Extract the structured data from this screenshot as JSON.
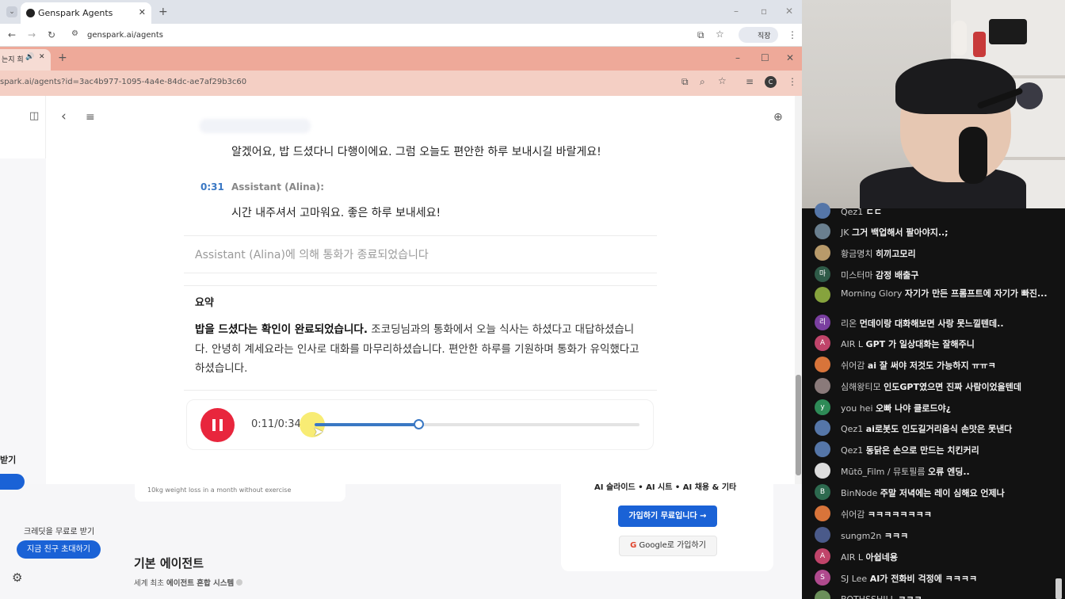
{
  "back_browser": {
    "tab_title": "Genspark Agents",
    "url": "genspark.ai/agents",
    "profile_label": "직장"
  },
  "front_browser": {
    "tab_title": "는지 희",
    "url": "spark.ai/agents?id=3ac4b977-1095-4a4e-84dc-ae7af29b3c60",
    "profile_initial": "C"
  },
  "transcript": {
    "top_message": "알겠어요, 밥 드셨다니 다행이에요. 그럼 오늘도 편안한 하루 보내시길 바랄게요!",
    "entry_time": "0:31",
    "entry_speaker": "Assistant (Alina):",
    "entry_message": "시간 내주셔서 고마워요. 좋은 하루 보내세요!",
    "end_notice": "Assistant (Alina)에 의해 통화가 종료되었습니다"
  },
  "summary": {
    "title": "요약",
    "bold_sentence": "밥을 드셨다는 확인이 완료되었습니다.",
    "body": " 조코딩님과의 통화에서 오늘 식사는 하셨다고 대답하셨습니다. 안녕히 계세요라는 인사로 대화를 마무리하셨습니다. 편안한 하루를 기원하며 통화가 유익했다고 하셨습니다."
  },
  "player": {
    "time": "0:11/0:34",
    "progress": 0.32
  },
  "lower_page": {
    "card_hint": "10kg weight loss in a month without exercise",
    "credit_text": "크레딧을 무료로 받기",
    "invite_button": "지금 친구 초대하기",
    "side_label": "받기",
    "section_title": "기본 에이전트",
    "section_sub_prefix": "세계 최초 ",
    "section_sub_bold": "에이전트 혼합 시스템",
    "right_card_heading": "AI 슬라이드 • AI 시트 • AI 채용 & 기타",
    "signup_button": "가입하기  무료입니다  →",
    "google_button": "Google로 가입하기"
  },
  "chat": [
    {
      "avatar": "",
      "user": "Qez1",
      "text": "ㄷㄷ",
      "color": "#5576a8"
    },
    {
      "avatar": "",
      "user": "JK",
      "text": "그거 백업해서 팔아야지..;",
      "color": "#6a7f8f"
    },
    {
      "avatar": "",
      "user": "황금명치",
      "text": "히끼고모리",
      "color": "#b89a6a"
    },
    {
      "avatar": "마",
      "user": "미스터마",
      "text": "감정 배출구",
      "color": "#2f5b48"
    },
    {
      "avatar": "",
      "user": "Morning Glory",
      "text": "자기가 만든 프롬프트에 자기가 빠진...",
      "color": "#86a33d"
    },
    {
      "avatar": "리",
      "user": "리온",
      "text": "먼데이랑 대화해보면 사랑 못느낄텐데..",
      "color": "#7a3fa0"
    },
    {
      "avatar": "A",
      "user": "AIR L",
      "text": "GPT 가 일상대화는 잘해주니",
      "color": "#c0446a"
    },
    {
      "avatar": "",
      "user": "쉬어감",
      "text": "ai 잘 써야 저것도 가능하지 ㅠㅠㅋ",
      "color": "#d8743a"
    },
    {
      "avatar": "",
      "user": "심해왕티모",
      "text": "인도GPT였으면 진짜 사람이었을텐데",
      "color": "#8a7a7a"
    },
    {
      "avatar": "y",
      "user": "you hei",
      "text": "오빠 나야 클로드야¿",
      "color": "#2e8b57"
    },
    {
      "avatar": "",
      "user": "Qez1",
      "text": "ai로봇도 인도길거리음식 손맛은 못낸다",
      "color": "#5576a8"
    },
    {
      "avatar": "",
      "user": "Qez1",
      "text": "동닭은 손으로 만드는 치킨커리",
      "color": "#5576a8"
    },
    {
      "avatar": "",
      "user": "Mūtō_Film / 뮤토필름",
      "text": "오류 엔딩..",
      "color": "#dddddd"
    },
    {
      "avatar": "B",
      "user": "BinNode",
      "text": "주말 저녁에는 레이 심해요 언제나",
      "color": "#2d6a4f"
    },
    {
      "avatar": "",
      "user": "쉬어감",
      "text": "ㅋㅋㅋㅋㅋㅋㅋㅋ",
      "color": "#d8743a"
    },
    {
      "avatar": "",
      "user": "sungm2n",
      "text": "ㅋㅋㅋ",
      "color": "#4a5a8a"
    },
    {
      "avatar": "A",
      "user": "AIR L",
      "text": "아쉽네용",
      "color": "#c0446a"
    },
    {
      "avatar": "S",
      "user": "SJ Lee",
      "text": "AI가 전화비 걱정에 ㅋㅋㅋㅋ",
      "color": "#b04a8e"
    },
    {
      "avatar": "",
      "user": "BOTHSSHILL",
      "text": "ㅋㅋㅋ",
      "color": "#6b8f5a"
    }
  ]
}
